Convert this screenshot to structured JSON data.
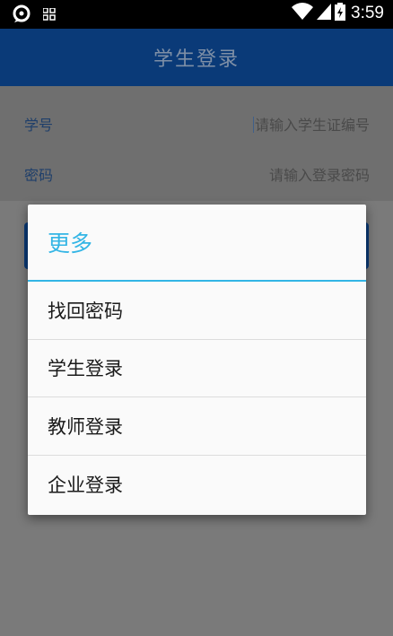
{
  "status_bar": {
    "time": "3:59",
    "icons": [
      "app-notification-icon",
      "grid-icon",
      "wifi-icon",
      "signal-icon",
      "battery-icon"
    ]
  },
  "app_bar": {
    "title": "学生登录"
  },
  "form": {
    "student_id": {
      "label": "学号",
      "placeholder": "请输入学生证编号"
    },
    "password": {
      "label": "密码",
      "placeholder": "请输入登录密码"
    }
  },
  "dialog": {
    "title": "更多",
    "options": [
      "找回密码",
      "学生登录",
      "教师登录",
      "企业登录"
    ]
  },
  "colors": {
    "app_bar": "#0a3a78",
    "accent": "#33b5e5",
    "scrim_background": "#7a7a7a",
    "dialog_background": "#fafafa"
  }
}
